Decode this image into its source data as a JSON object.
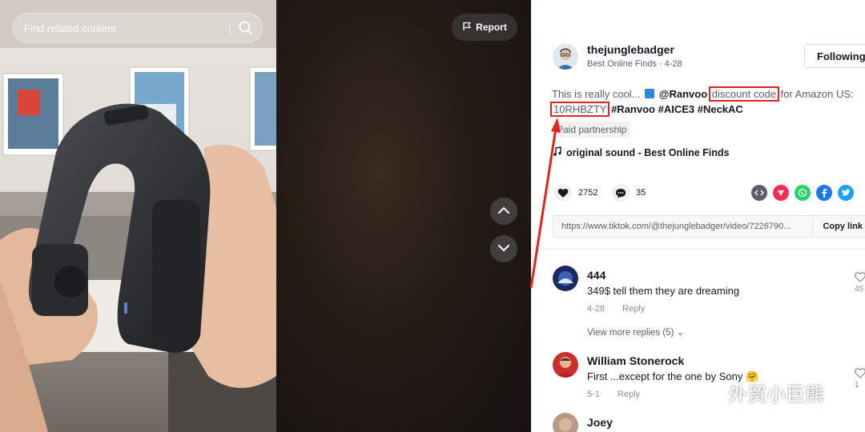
{
  "search": {
    "placeholder": "Find related content"
  },
  "video": {
    "report_label": "Report"
  },
  "author": {
    "username": "thejunglebadger",
    "display": "Best Online Finds",
    "date": "4-28",
    "follow_label": "Following"
  },
  "description": {
    "intro": "This is really cool... ",
    "mention": "@Ranvoo",
    "highlight": "discount code",
    "suffix": " for Amazon US:",
    "code": "10RHBZTY",
    "hashtags": " #Ranvoo #AICE3 #NeckAC"
  },
  "paid_label": "Paid partnership",
  "sound_label": "original sound - Best Online Finds",
  "stats": {
    "likes": "2752",
    "comments": "35"
  },
  "share_colors": {
    "embed": "#5b5e6a",
    "send": "#fe2c55",
    "whatsapp": "#25d366",
    "facebook": "#1877f2",
    "twitter": "#1da1f2"
  },
  "link": {
    "url": "https://www.tiktok.com/@thejunglebadger/video/7226790...",
    "copy_label": "Copy link"
  },
  "comments": [
    {
      "name": "444",
      "text": "349$ tell them they are dreaming",
      "date": "4-28",
      "reply_label": "Reply",
      "likes": "45"
    },
    {
      "name": "William Stonerock",
      "text": "First ...except for the one by Sony 🤗",
      "date": "5-1",
      "reply_label": "Reply",
      "likes": "1"
    },
    {
      "name": "Joey"
    }
  ],
  "view_more_label": "View more replies (5)",
  "watermark": "外贸小巨熊",
  "colors": {
    "accent_red": "#e0251b",
    "tiktok_pink": "#fe2c55"
  }
}
